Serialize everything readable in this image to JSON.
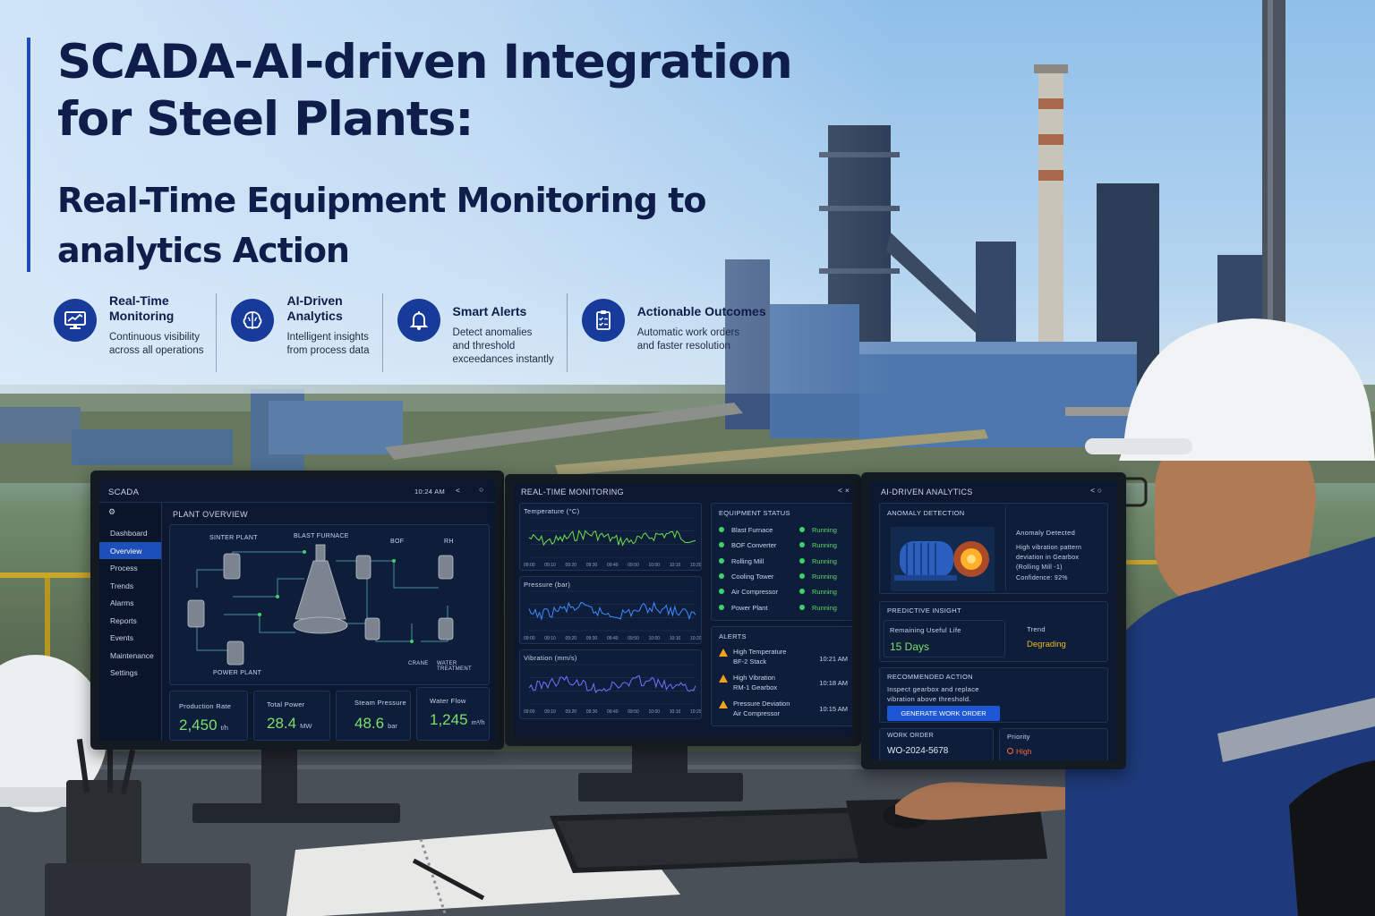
{
  "header": {
    "title_line1": "SCADA-AI-driven Integration",
    "title_line2": "for Steel Plants:",
    "subtitle_line1": "Real-Time Equipment Monitoring to",
    "subtitle_line2": "analytics Action"
  },
  "features": [
    {
      "icon": "monitor-chart-icon",
      "title1": "Real-Time",
      "title2": "Monitoring",
      "desc1": "Continuous visibility",
      "desc2": "across all operations"
    },
    {
      "icon": "brain-icon",
      "title1": "AI-Driven",
      "title2": "Analytics",
      "desc1": "Intelligent insights",
      "desc2": "from process data"
    },
    {
      "icon": "bell-icon",
      "title1": "Smart Alerts",
      "title2": "",
      "desc1": "Detect anomalies",
      "desc2": "and threshold",
      "desc3": "exceedances instantly"
    },
    {
      "icon": "checklist-icon",
      "title1": "Actionable Outcomes",
      "title2": "",
      "desc1": "Automatic work orders",
      "desc2": "and faster resolution"
    }
  ],
  "scada": {
    "app_name": "SCADA",
    "time": "10:24 AM",
    "nav": [
      "Dashboard",
      "Overview",
      "Process",
      "Trends",
      "Alarms",
      "Reports",
      "Events",
      "Maintenance",
      "Settings"
    ],
    "active_nav": "Overview",
    "overview_title": "PLANT OVERVIEW",
    "units": [
      "SINTER PLANT",
      "BLAST FURNACE",
      "BOF",
      "RH",
      "POWER PLANT",
      "CRANE",
      "WATER TREATMENT"
    ],
    "kpis": [
      {
        "label": "Production Rate",
        "value": "2,450",
        "unit": "t/h"
      },
      {
        "label": "Total Power",
        "value": "28.4",
        "unit": "MW"
      },
      {
        "label": "Steam Pressure",
        "value": "48.6",
        "unit": "bar"
      },
      {
        "label": "Water Flow",
        "value": "1,245",
        "unit": "m³/h"
      }
    ]
  },
  "monitoring": {
    "title": "REAL-TIME MONITORING",
    "charts": [
      {
        "label": "Temperature (°C)",
        "color": "#6ee04c"
      },
      {
        "label": "Pressure (bar)",
        "color": "#3d8cff"
      },
      {
        "label": "Vibration (mm/s)",
        "color": "#7a6dff"
      }
    ],
    "time_ticks": [
      "09:00",
      "09:10",
      "09:20",
      "09:30",
      "09:40",
      "09:50",
      "10:00",
      "10:10",
      "10:20"
    ],
    "equipment_title": "EQUIPMENT STATUS",
    "equipment": [
      {
        "name": "Blast Furnace",
        "status": "Running"
      },
      {
        "name": "BOF Converter",
        "status": "Running"
      },
      {
        "name": "Rolling Mill",
        "status": "Running"
      },
      {
        "name": "Cooling Tower",
        "status": "Running"
      },
      {
        "name": "Air Compressor",
        "status": "Running"
      },
      {
        "name": "Power Plant",
        "status": "Running"
      }
    ],
    "alerts_title": "ALERTS",
    "alerts": [
      {
        "line1": "High Temperature",
        "line2": "BF-2 Stack",
        "time": "10:21 AM"
      },
      {
        "line1": "High Vibration",
        "line2": "RM-1 Gearbox",
        "time": "10:18 AM"
      },
      {
        "line1": "Pressure Deviation",
        "line2": "Air Compressor",
        "time": "10:15 AM"
      }
    ]
  },
  "analytics": {
    "title": "AI-DRIVEN ANALYTICS",
    "anomaly_title": "ANOMALY DETECTION",
    "anomaly_label": "Anomaly Detected",
    "anomaly_desc1": "High vibration pattern",
    "anomaly_desc2": "deviation in Gearbox",
    "anomaly_desc3": "(Rolling Mill -1)",
    "confidence": "Confidence: 92%",
    "insight_title": "PREDICTIVE INSIGHT",
    "rul_label": "Remaining Useful Life",
    "rul_value": "15 Days",
    "trend_label": "Trend",
    "trend_value": "Degrading",
    "action_title": "RECOMMENDED ACTION",
    "action_desc1": "Inspect gearbox and replace",
    "action_desc2": "vibration above threshold.",
    "button_label": "GENERATE WORK ORDER",
    "wo_label": "WORK ORDER",
    "wo_value": "WO-2024-5678",
    "priority_label": "Priority",
    "priority_value": "High"
  },
  "colors": {
    "accent": "#1e4bb8",
    "navy": "#0f1d4a",
    "ok": "#5fd66a",
    "warn": "#f0a21a",
    "degrading": "#f0b81a"
  }
}
